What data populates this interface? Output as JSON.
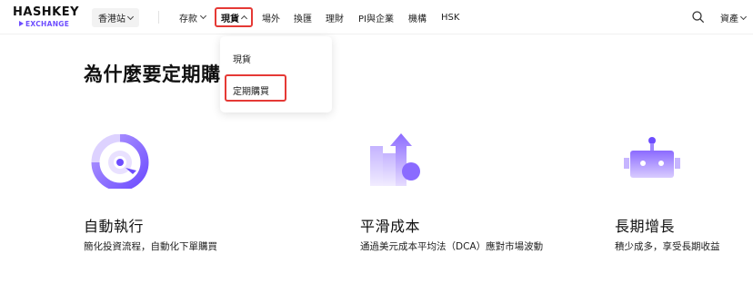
{
  "header": {
    "logo": {
      "main": "HASHKEY",
      "sub": "EXCHANGE"
    },
    "region": {
      "label": "香港站",
      "icon": "chevron-down-icon"
    },
    "nav": [
      {
        "label": "存款",
        "has_dropdown": true
      },
      {
        "label": "現貨",
        "has_dropdown": true,
        "active": true
      },
      {
        "label": "場外"
      },
      {
        "label": "換匯"
      },
      {
        "label": "理財"
      },
      {
        "label": "PI與企業"
      },
      {
        "label": "機構"
      },
      {
        "label": "HSK"
      }
    ],
    "search_icon": "search-icon",
    "assets": {
      "label": "資產",
      "icon": "chevron-down-icon"
    }
  },
  "dropdown": {
    "items": [
      {
        "label": "現貨"
      },
      {
        "label": "定期購買",
        "highlighted": true
      }
    ]
  },
  "main": {
    "title": "為什麼要定期購",
    "features": [
      {
        "icon": "target-icon",
        "title": "自動執行",
        "desc": "簡化投資流程，自動化下單購買"
      },
      {
        "icon": "growth-chart-icon",
        "title": "平滑成本",
        "desc": "通過美元成本平均法（DCA）應對市場波動"
      },
      {
        "icon": "robot-icon",
        "title": "長期增長",
        "desc": "積少成多，享受長期收益"
      }
    ]
  },
  "colors": {
    "accent": "#6d4dff",
    "highlight_border": "#e53935",
    "icon_purple_light": "#c9b8ff"
  }
}
